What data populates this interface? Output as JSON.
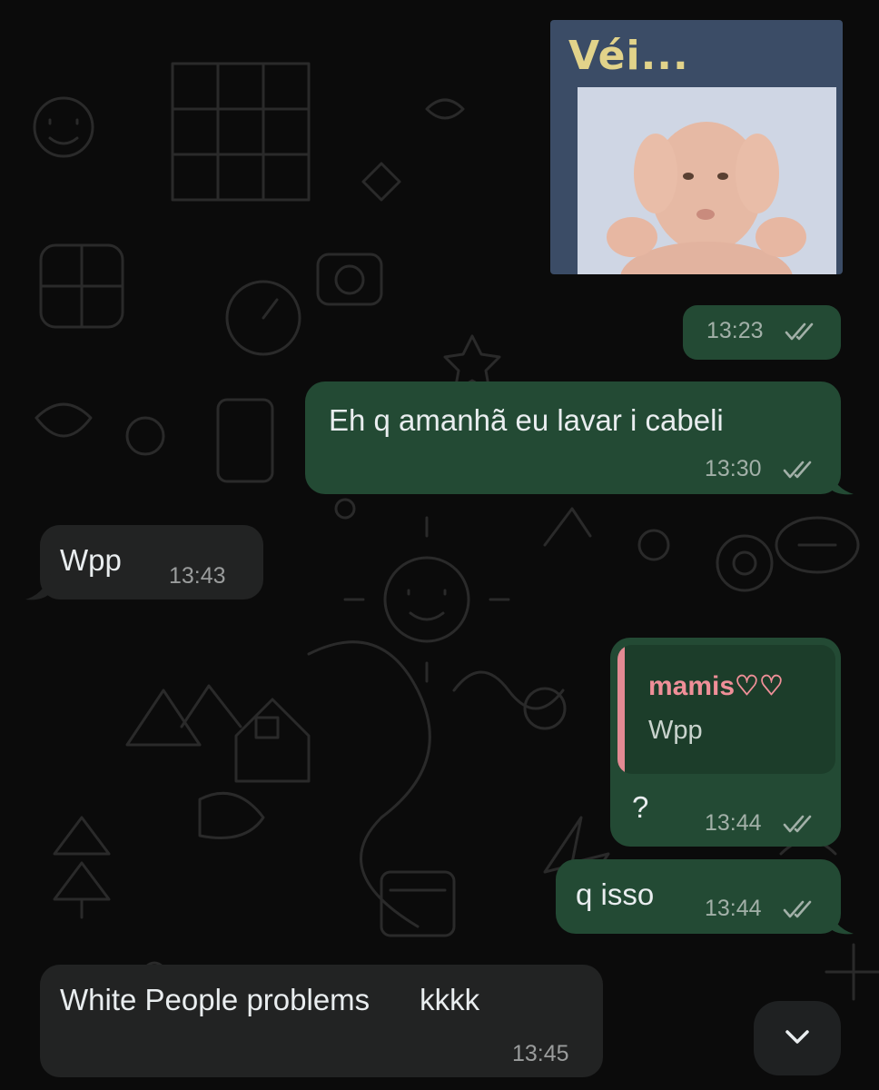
{
  "chat": {
    "sticker": {
      "caption": "Véi...",
      "time": "13:23"
    },
    "messages": [
      {
        "text": "Eh q amanhã eu lavar i cabeli",
        "time": "13:30"
      },
      {
        "text": "Wpp",
        "time": "13:43"
      },
      {
        "text": "?",
        "time": "13:44",
        "reply": {
          "author": "mamis♡♡",
          "text": "Wpp"
        }
      },
      {
        "text": "q isso",
        "time": "13:44"
      },
      {
        "text": "White People problems      kkkk",
        "time": "13:45"
      }
    ]
  },
  "colors": {
    "outgoing_bubble": "#234a34",
    "incoming_bubble": "#222323",
    "reply_accent": "#e38a93",
    "background": "#0b0b0b"
  },
  "icons": {
    "read_receipt": "double-check-icon",
    "scroll_down": "chevron-down-icon"
  }
}
